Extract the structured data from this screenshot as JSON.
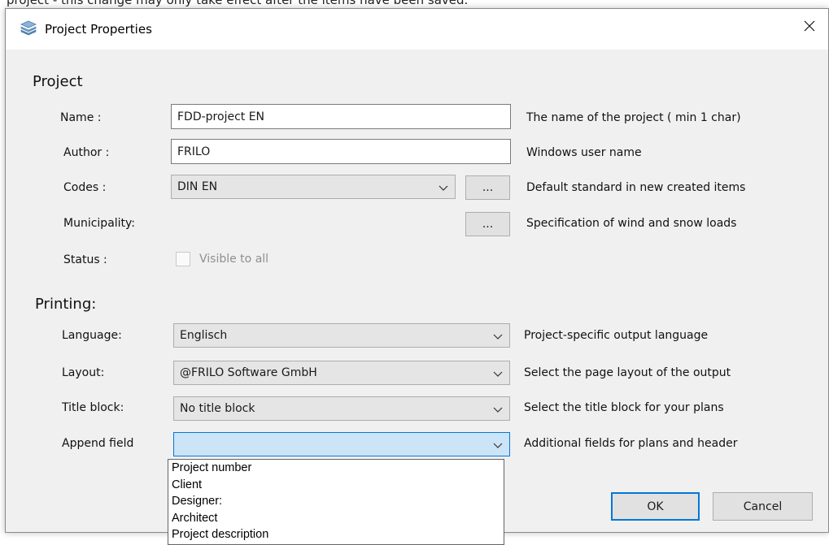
{
  "top_note": "project - this change may only take effect after the items have been saved.",
  "window": {
    "title": "Project Properties"
  },
  "project_section": {
    "title": "Project",
    "name": {
      "label": "Name :",
      "value": "FDD-project EN",
      "description": "The name of the project ( min 1 char)"
    },
    "author": {
      "label": "Author :",
      "value": "FRILO",
      "description": "Windows user name"
    },
    "codes": {
      "label": "Codes :",
      "value": "DIN EN",
      "browse_label": "...",
      "description": "Default standard in new created  items"
    },
    "municipality": {
      "label": "Municipality:",
      "browse_label": "...",
      "description": "Specification of wind and snow loads"
    },
    "status": {
      "label": "Status :",
      "checkbox_label": "Visible to all"
    }
  },
  "printing_section": {
    "title": "Printing:",
    "language": {
      "label": "Language:",
      "value": "Englisch",
      "description": "Project-specific output language"
    },
    "layout": {
      "label": "Layout:",
      "value": "@FRILO Software GmbH",
      "description": "Select the page layout of the output"
    },
    "title_block": {
      "label": "Title block:",
      "value": "No title block",
      "description": "Select the title block for your plans"
    },
    "append_field": {
      "label": "Append field",
      "value": "",
      "description": "Additional fields for plans and header"
    }
  },
  "dropdown_options": [
    "Project number",
    "Client",
    "Designer:",
    "Architect",
    "Project description"
  ],
  "buttons": {
    "ok": "OK",
    "cancel": "Cancel"
  }
}
